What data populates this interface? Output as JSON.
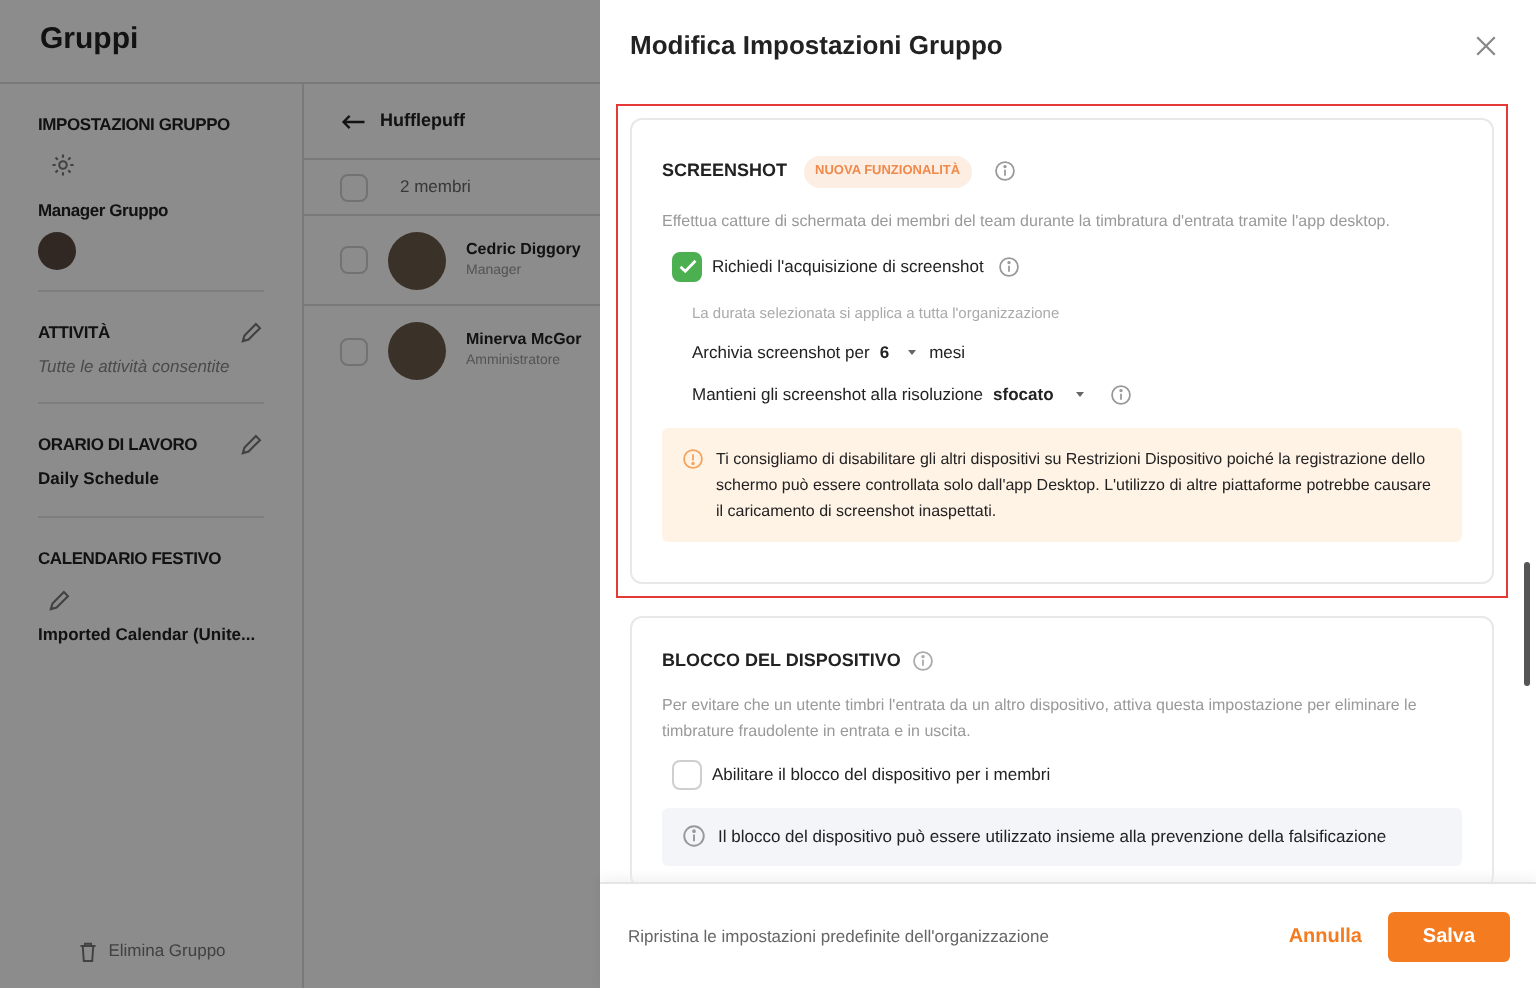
{
  "app": {
    "title": "Gruppi",
    "sections": [
      {
        "kind": "gear",
        "title": "IMPOSTAZIONI GRUPPO"
      },
      {
        "kind": "avatar",
        "title": "Manager Gruppo"
      },
      {
        "kind": "edit",
        "title": "ATTIVITÀ",
        "subtitle": "Tutte le attività consentite",
        "italic": true
      },
      {
        "kind": "edit",
        "title": "ORARIO DI LAVORO",
        "subtitle": "Daily Schedule",
        "italic": false
      },
      {
        "kind": "edit-below",
        "title": "CALENDARIO FESTIVO",
        "subtitle": "Imported Calendar (Unite...",
        "italic": false
      }
    ],
    "delete_button": "Elimina Gruppo",
    "group_name": "Hufflepuff",
    "select_all": {
      "label": "2 membri",
      "checked": false
    },
    "members": [
      {
        "name": "Cedric Diggory",
        "role": "Manager",
        "checked": false
      },
      {
        "name": "Minerva McGor",
        "role": "Amministratore",
        "checked": false
      }
    ]
  },
  "drawer": {
    "title": "Modifica Impostazioni Gruppo",
    "screenshot": {
      "title": "SCREENSHOT",
      "badge": "NUOVA FUNZIONALITÀ",
      "description": "Effettua catture di schermata dei membri del team durante la timbratura d'entrata tramite l'app desktop.",
      "checkbox": {
        "label": "Richiedi l'acquisizione di screenshot",
        "checked": true
      },
      "note": "La durata selezionata si applica a tutta l'organizzazione",
      "archive": {
        "label": "Archivia screenshot per",
        "value": "6",
        "suffix": "mesi"
      },
      "resolution": {
        "label": "Mantieni gli screenshot alla risoluzione",
        "value": "sfocato"
      },
      "warning": "Ti consigliamo di disabilitare gli altri dispositivi su Restrizioni Dispositivo poiché la registrazione dello schermo può essere controllata solo dall'app Desktop. L'utilizzo di altre piattaforme potrebbe causare il caricamento di screenshot inaspettati."
    },
    "device_lock": {
      "title": "BLOCCO DEL DISPOSITIVO",
      "description": "Per evitare che un utente timbri l'entrata da un altro dispositivo, attiva questa impostazione per eliminare le timbrature fraudolente in entrata e in uscita.",
      "checkbox": {
        "label": "Abilitare il blocco del dispositivo per i membri",
        "checked": false
      },
      "info": "Il blocco del dispositivo può essere utilizzato insieme alla prevenzione della falsificazione"
    },
    "footer": {
      "reset": "Ripristina le impostazioni predefinite dell'organizzazione",
      "cancel": "Annulla",
      "save": "Salva"
    }
  }
}
